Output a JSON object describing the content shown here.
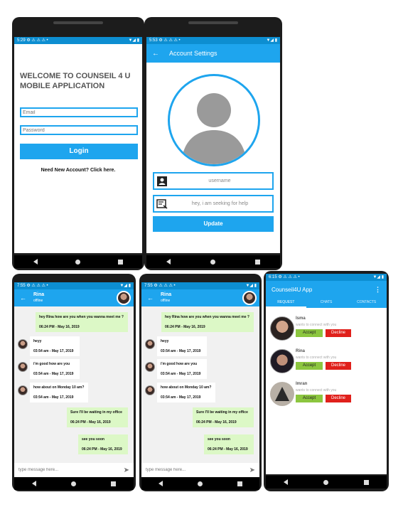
{
  "login": {
    "status_time": "5:29",
    "status_icons": "⚙ ⚠ ⚠ ⚠ •",
    "status_right": "▼◢ ▮",
    "welcome": "WELCOME TO COUNSEIL 4 U MOBILE APPLICATION",
    "email_placeholder": "Email",
    "password_placeholder": "Password",
    "login_label": "Login",
    "signup_text": "Need New Account? Click here."
  },
  "account": {
    "status_time": "5:53",
    "status_icons": "⚙ ⚠ ⚠ ⚠ •",
    "status_right": "▼◢ ▮",
    "back_icon": "←",
    "title": "Account Settings",
    "username_placeholder": "username",
    "status_placeholder": "hey, i am seeking for help",
    "update_label": "Update"
  },
  "chat1": {
    "status_time": "7:55",
    "status_icons": "⚙ ⚠ ⚠ ⚠ •",
    "status_right": "▼◢ ▮",
    "back_icon": "←",
    "contact_name": "Rina",
    "contact_status": "offline",
    "messages": [
      {
        "text": "hey Rina how are you when you wanna meet me ?",
        "time": "06:24 PM - May 16, 2019"
      },
      {
        "text": "heyy",
        "time": "03:54 am - May 17, 2019"
      },
      {
        "text": "i'm good how are you",
        "time": "03:54 am - May 17, 2019"
      },
      {
        "text": "how about on Monday 10 am?",
        "time": "03:54 am - May 17, 2019"
      },
      {
        "text": "Sure I'll be waiting in my office",
        "time": "06:24 PM - May 16, 2019"
      },
      {
        "text": "see you soon",
        "time": "06:24 PM - May 16, 2019"
      }
    ],
    "input_placeholder": "type message here...",
    "send_icon": "➤"
  },
  "chat2": {
    "status_time": "7:55",
    "status_icons": "⚙ ⚠ ⚠ ⚠ •",
    "status_right": "▼◢ ▮",
    "back_icon": "←",
    "contact_name": "Rina",
    "contact_status": "offline",
    "messages": [
      {
        "text": "hey Rina how are you when you wanna meet me ?",
        "time": "06:24 PM - May 16, 2019"
      },
      {
        "text": "heyy",
        "time": "03:54 am - May 17, 2019"
      },
      {
        "text": "i'm good how are you",
        "time": "03:54 am - May 17, 2019"
      },
      {
        "text": "how about on Monday 10 am?",
        "time": "03:54 am - May 17, 2019"
      },
      {
        "text": "Sure I'll be waiting in my office",
        "time": "06:24 PM - May 16, 2019"
      },
      {
        "text": "see you soon",
        "time": "06:24 PM - May 16, 2019"
      }
    ],
    "input_placeholder": "type message here...",
    "send_icon": "➤"
  },
  "requests": {
    "status_time": "6:15",
    "status_icons": "⚙ ⚠ ⚠ ⚠ •",
    "status_right": "▼◢ ▮",
    "app_title": "Counseil4U App",
    "menu_icon": "⋮",
    "tabs": [
      "REQUEST",
      "CHATS",
      "CONTACTS"
    ],
    "items": [
      {
        "name": "Isma",
        "subtitle": "wants to connect with you",
        "accept": "Accept",
        "decline": "Decline"
      },
      {
        "name": "Rina",
        "subtitle": "wants to connect with you",
        "accept": "Accept",
        "decline": "Decline"
      },
      {
        "name": "Imran",
        "subtitle": "wants to connect with you",
        "accept": "Accept",
        "decline": "Decline"
      }
    ]
  },
  "colors": {
    "primary": "#1ea5ee",
    "status_bar": "#0d8ed1",
    "accept_green": "#8cc63f",
    "decline_red": "#e0201b",
    "sent_bubble": "#dcf8c6"
  }
}
